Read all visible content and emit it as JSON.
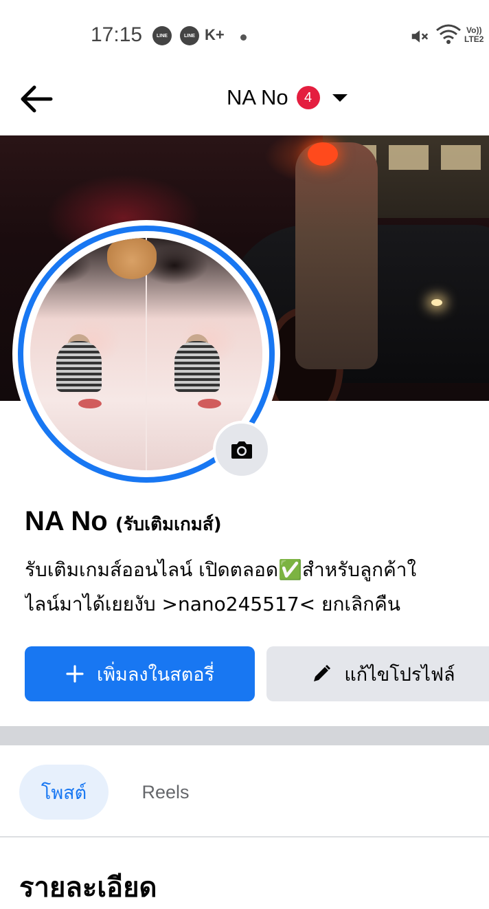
{
  "status_bar": {
    "time": "17:15",
    "notification_icons": [
      "line-icon",
      "line-icon",
      "k-plus-icon",
      "dot-icon"
    ],
    "k_plus_label": "K+",
    "line_label": "LINE",
    "right_icons": [
      "mute-icon",
      "wifi-icon",
      "volte-icon"
    ],
    "volte_label_top": "Vo))",
    "volte_label_bottom": "LTE2"
  },
  "nav": {
    "back_icon": "arrow-left-icon",
    "title": "NA No",
    "badge_count": "4",
    "dropdown_icon": "caret-down-icon"
  },
  "profile": {
    "name": "NA No",
    "name_sub": "(รับเติมเกมส์)",
    "bio_line1": "รับเติมเกมส์ออนไลน์ เปิดตลอด✅สำหรับลูกค้าใ",
    "bio_line2": "ไลน์มาได้เยยงับ   >nano245517<    ยกเลิกคืน",
    "camera_icon": "camera-icon"
  },
  "actions": {
    "add_story_label": "เพิ่มลงในสตอรี่",
    "add_story_icon": "plus-icon",
    "edit_profile_label": "แก้ไขโปรไฟล์",
    "edit_profile_icon": "pencil-icon"
  },
  "tabs": [
    {
      "label": "โพสต์",
      "active": true
    },
    {
      "label": "Reels",
      "active": false
    }
  ],
  "section_title": "รายละเอียด",
  "colors": {
    "accent": "#1877f2",
    "badge": "#e41e3f",
    "secondary_button": "#e4e6eb",
    "active_tab_bg": "#e7f0fc"
  }
}
